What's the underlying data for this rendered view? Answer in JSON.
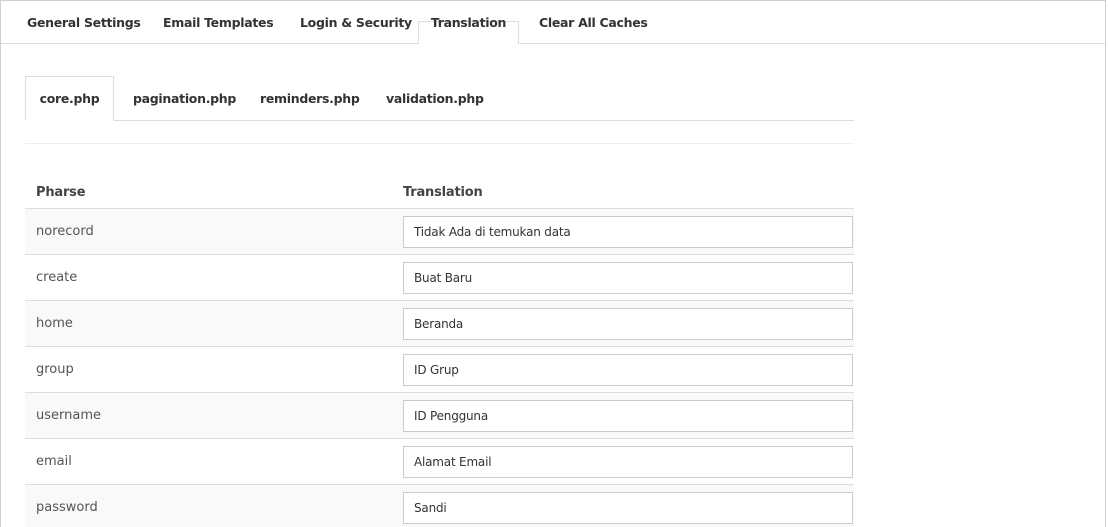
{
  "top_tabs": [
    {
      "label": "General Settings",
      "active": false
    },
    {
      "label": "Email Templates",
      "active": false
    },
    {
      "label": "Login & Security",
      "active": false
    },
    {
      "label": "Translation",
      "active": true
    },
    {
      "label": "Clear All Caches",
      "active": false
    }
  ],
  "sub_tabs": [
    {
      "label": "core.php",
      "active": true
    },
    {
      "label": "pagination.php",
      "active": false
    },
    {
      "label": "reminders.php",
      "active": false
    },
    {
      "label": "validation.php",
      "active": false
    }
  ],
  "table": {
    "headers": {
      "phrase": "Pharse",
      "translation": "Translation"
    },
    "rows": [
      {
        "phrase": "norecord",
        "translation": "Tidak Ada di temukan data"
      },
      {
        "phrase": "create",
        "translation": "Buat Baru"
      },
      {
        "phrase": "home",
        "translation": "Beranda"
      },
      {
        "phrase": "group",
        "translation": "ID Grup"
      },
      {
        "phrase": "username",
        "translation": "ID Pengguna"
      },
      {
        "phrase": "email",
        "translation": "Alamat Email"
      },
      {
        "phrase": "password",
        "translation": "Sandi"
      }
    ]
  }
}
